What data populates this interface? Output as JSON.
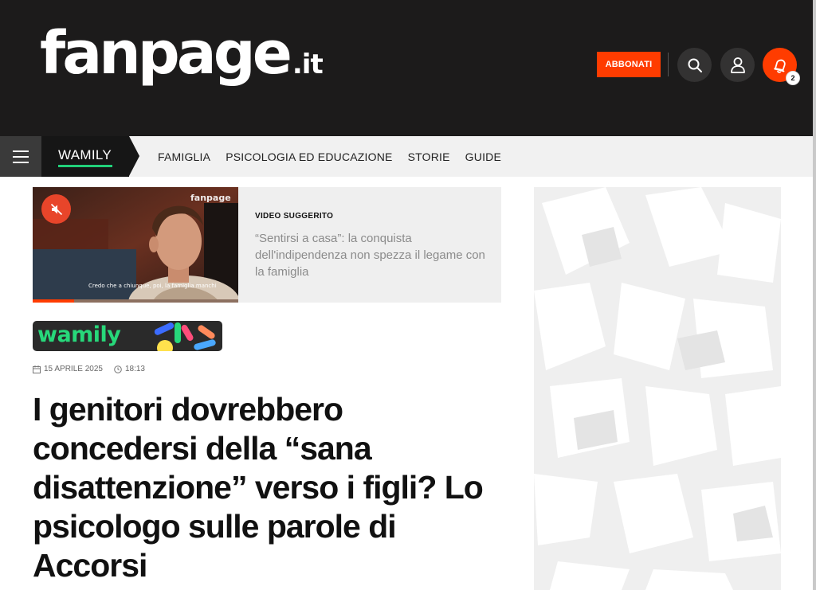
{
  "header": {
    "logo_main": "fanpage",
    "logo_tld": ".it",
    "subscribe_label": "ABBONATI",
    "notification_count": "2",
    "icons": {
      "search": "search-icon",
      "user": "user-icon",
      "notifications": "bell-icon"
    },
    "colors": {
      "background": "#1c1b1b",
      "accent": "#ff3c00"
    }
  },
  "nav": {
    "menu_icon": "hamburger-menu-icon",
    "section_label": "WAMILY",
    "section_accent": "#21d07a",
    "items": [
      {
        "label": "FAMIGLIA"
      },
      {
        "label": "PSICOLOGIA ED EDUCAZIONE"
      },
      {
        "label": "STORIE"
      },
      {
        "label": "GUIDE"
      }
    ]
  },
  "video": {
    "kicker": "VIDEO SUGGERITO",
    "title": "“Sentirsi a casa”: la conquista dell'indipendenza non spezza il legame con la famiglia",
    "thumbnail_logo": "fanpage",
    "caption": "Credo che a chiunque, poi, la famiglia manchi",
    "mute_icon": "muted-speaker-icon",
    "progress": 0.2
  },
  "article": {
    "banner_text": "wamily",
    "date": "15 APRILE 2025",
    "time": "18:13",
    "date_icon": "calendar-icon",
    "time_icon": "clock-icon",
    "headline": "I genitori dovrebbero concedersi della “sana disattenzione” verso i figli? Lo psicologo sulle parole di Accorsi"
  }
}
